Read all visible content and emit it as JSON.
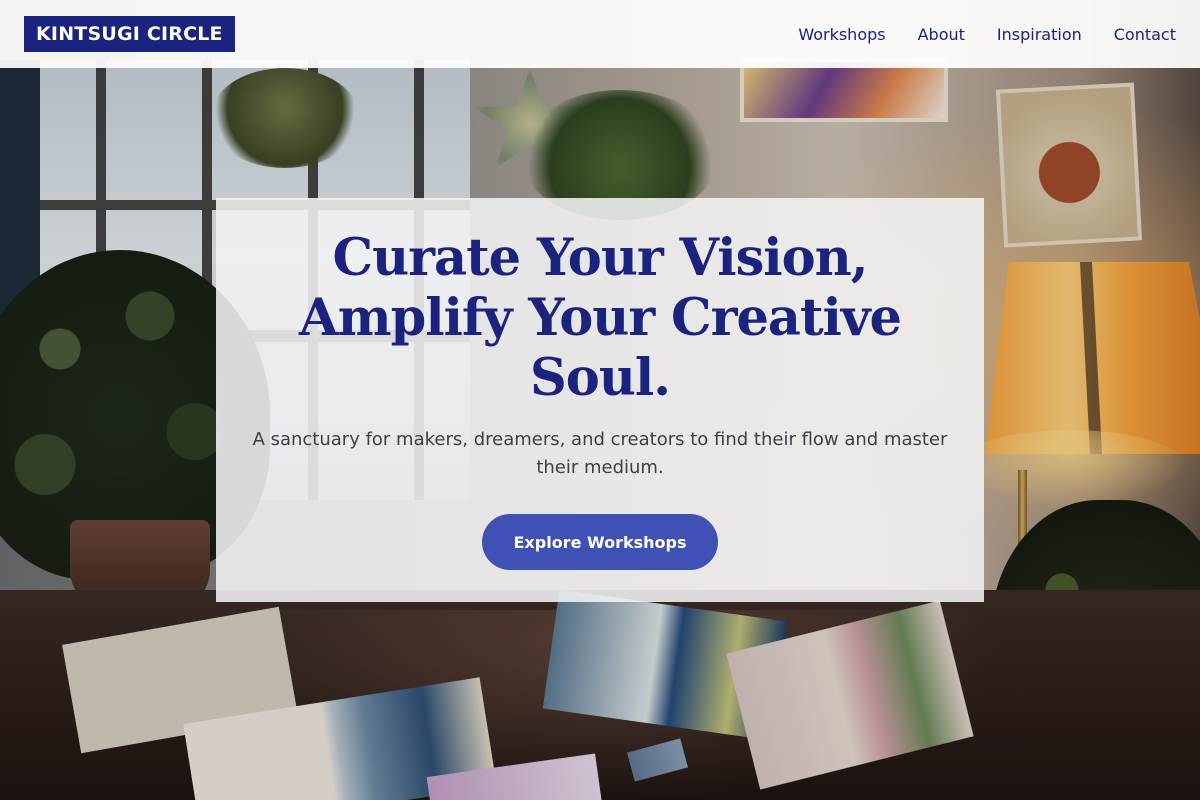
{
  "header": {
    "logo": "KINTSUGI CIRCLE",
    "nav": [
      {
        "label": "Workshops"
      },
      {
        "label": "About"
      },
      {
        "label": "Inspiration"
      },
      {
        "label": "Contact"
      }
    ]
  },
  "hero": {
    "title": "Curate Your Vision, Amplify Your Creative Soul.",
    "subtitle": "A sanctuary for makers, dreamers, and creators to find their flow and master their medium.",
    "cta_label": "Explore Workshops"
  },
  "colors": {
    "brand": "#1a237e",
    "accent": "#3f51b5",
    "header_bg": "#ffffff",
    "card_bg": "#f2f2f4"
  }
}
